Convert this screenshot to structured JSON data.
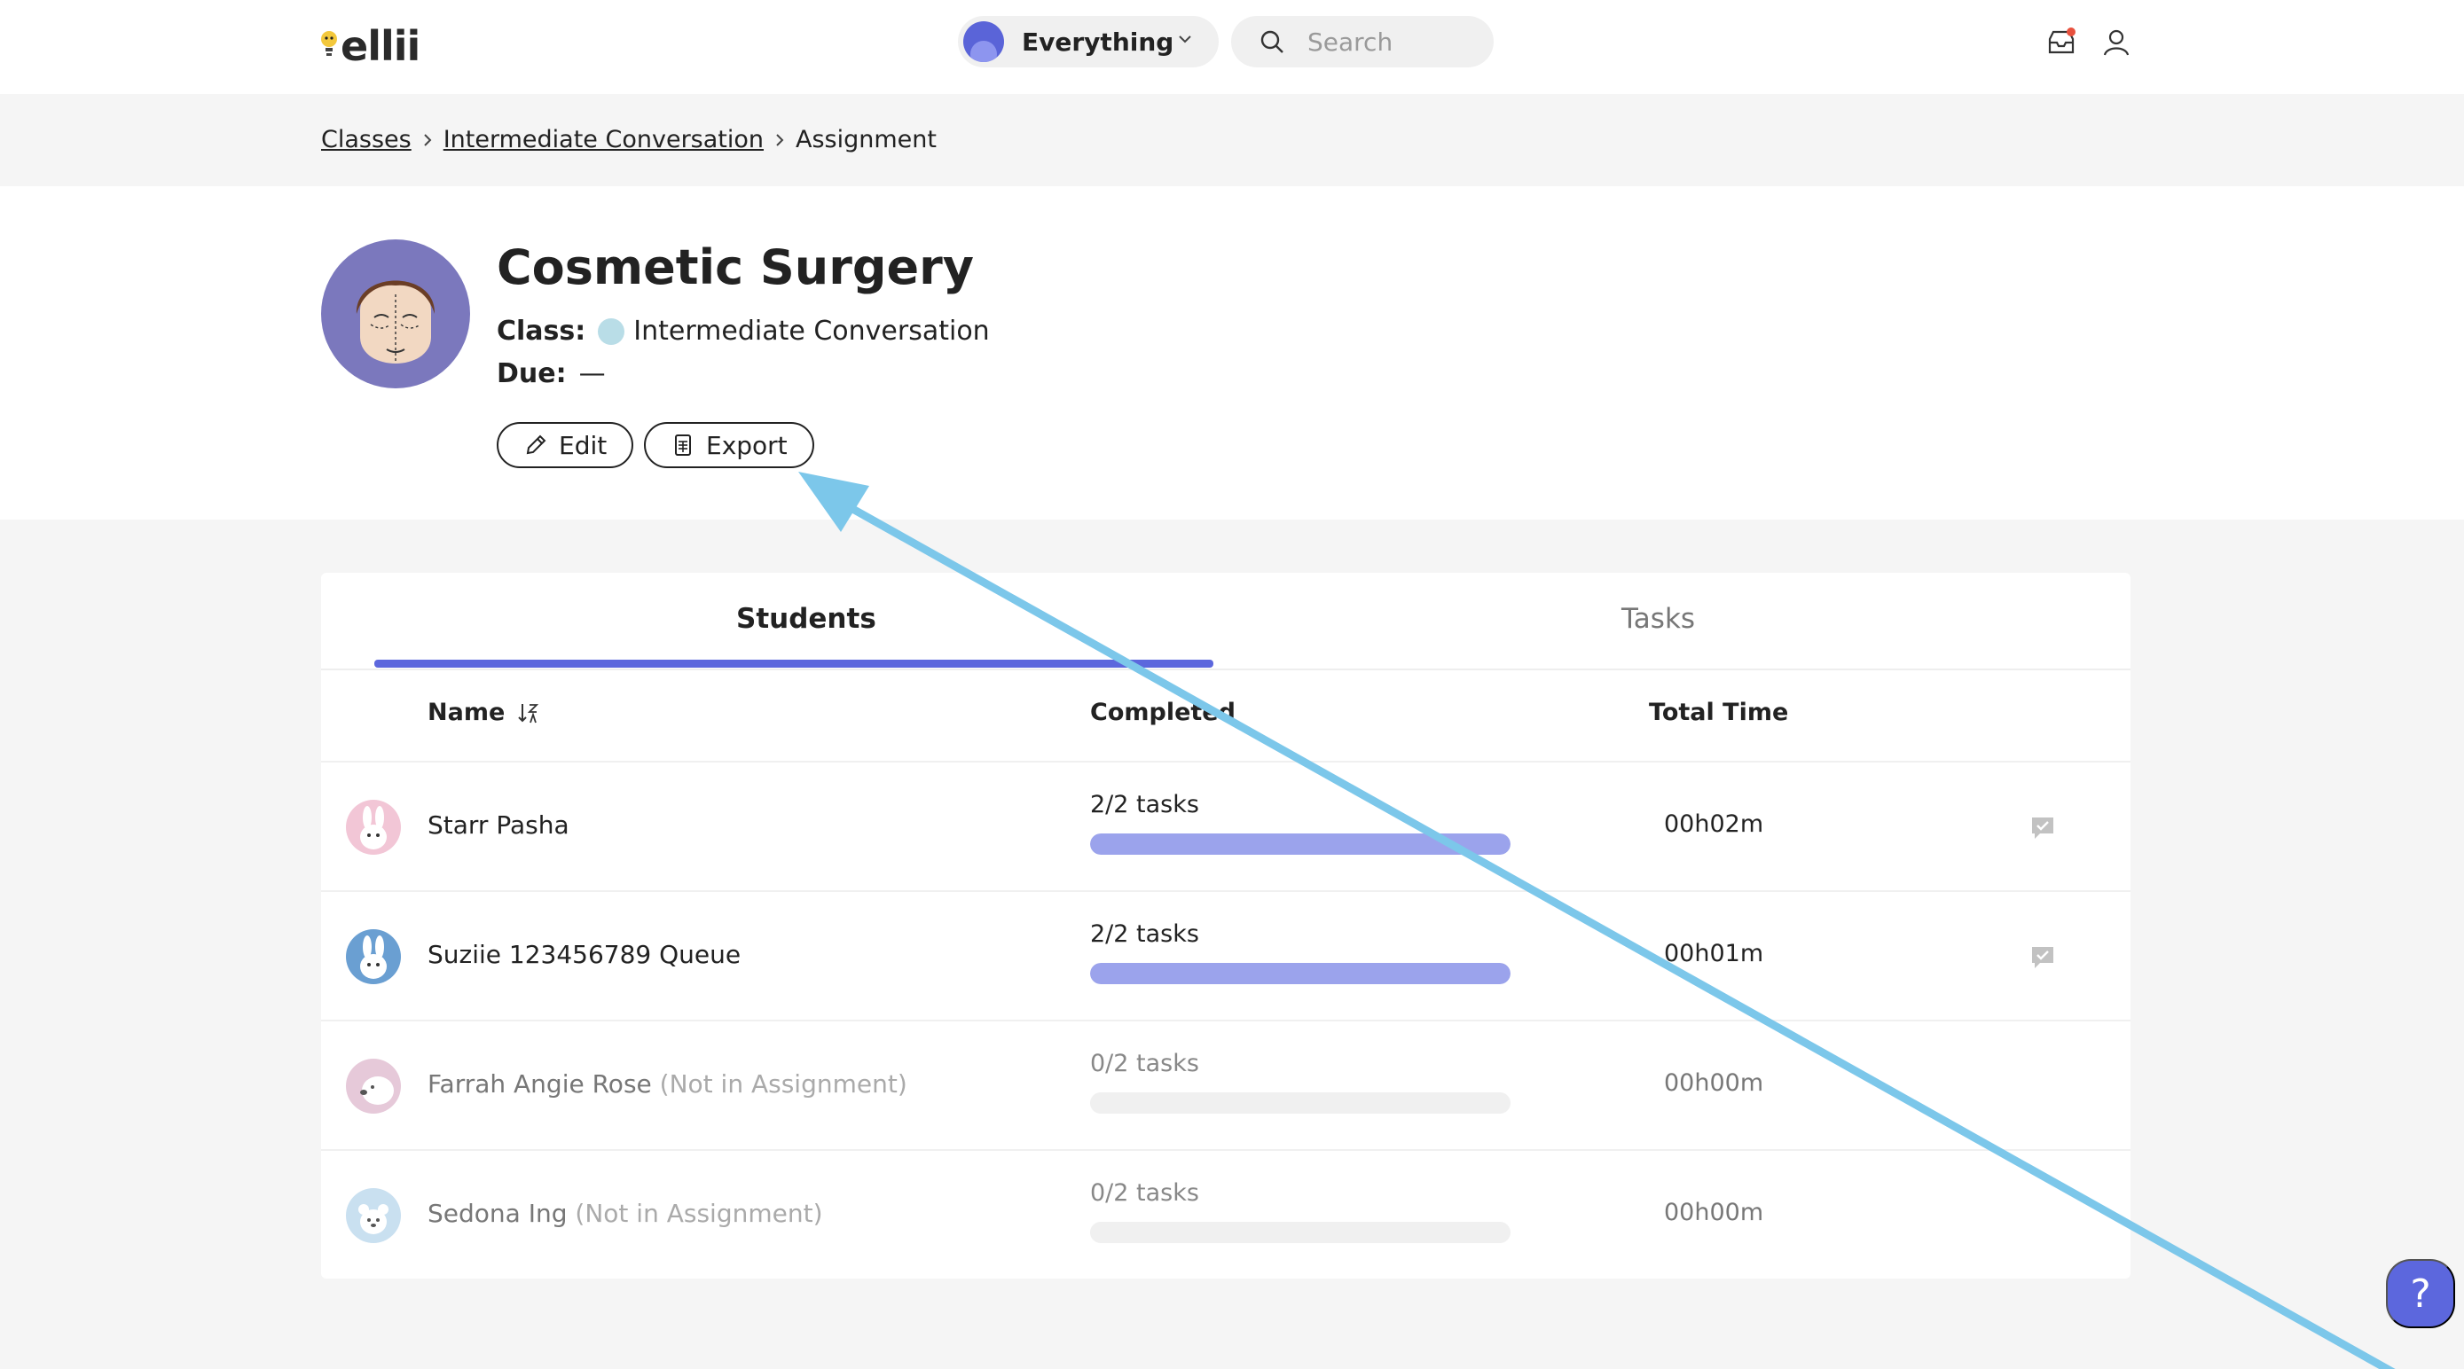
{
  "app": {
    "logo_text": "ellii"
  },
  "topbar": {
    "scope_label": "Everything",
    "search_placeholder": "Search"
  },
  "breadcrumb": {
    "items": [
      "Classes",
      "Intermediate Conversation",
      "Assignment"
    ]
  },
  "assignment": {
    "title": "Cosmetic Surgery",
    "class_key": "Class:",
    "class_value": "Intermediate Conversation",
    "due_key": "Due:",
    "due_value": "—",
    "edit_label": "Edit",
    "export_label": "Export"
  },
  "tabs": [
    {
      "label": "Students",
      "active": true
    },
    {
      "label": "Tasks",
      "active": false
    }
  ],
  "table": {
    "columns": [
      "Name",
      "Completed",
      "Total Time"
    ],
    "rows": [
      {
        "name": "Starr Pasha",
        "note": "",
        "tasks": "2/2 tasks",
        "progress": 1.0,
        "time": "00h02m",
        "has_message": true,
        "avatar_color": "#f2c6d6"
      },
      {
        "name": "Suziie 123456789 Queue",
        "note": "",
        "tasks": "2/2 tasks",
        "progress": 1.0,
        "time": "00h01m",
        "has_message": true,
        "avatar_color": "#6a9fd2"
      },
      {
        "name": "Farrah Angie Rose",
        "note": "(Not in Assignment)",
        "tasks": "0/2 tasks",
        "progress": 0.0,
        "time": "00h00m",
        "has_message": false,
        "avatar_color": "#e6c9d9"
      },
      {
        "name": "Sedona Ing",
        "note": "(Not in Assignment)",
        "tasks": "0/2 tasks",
        "progress": 0.0,
        "time": "00h00m",
        "has_message": false,
        "avatar_color": "#c9e0f0"
      }
    ]
  },
  "help": {
    "label": "?"
  },
  "colors": {
    "accent": "#5c67dd",
    "progress_fill": "#9ba3ec",
    "annotation_arrow": "#7cc7ea"
  }
}
